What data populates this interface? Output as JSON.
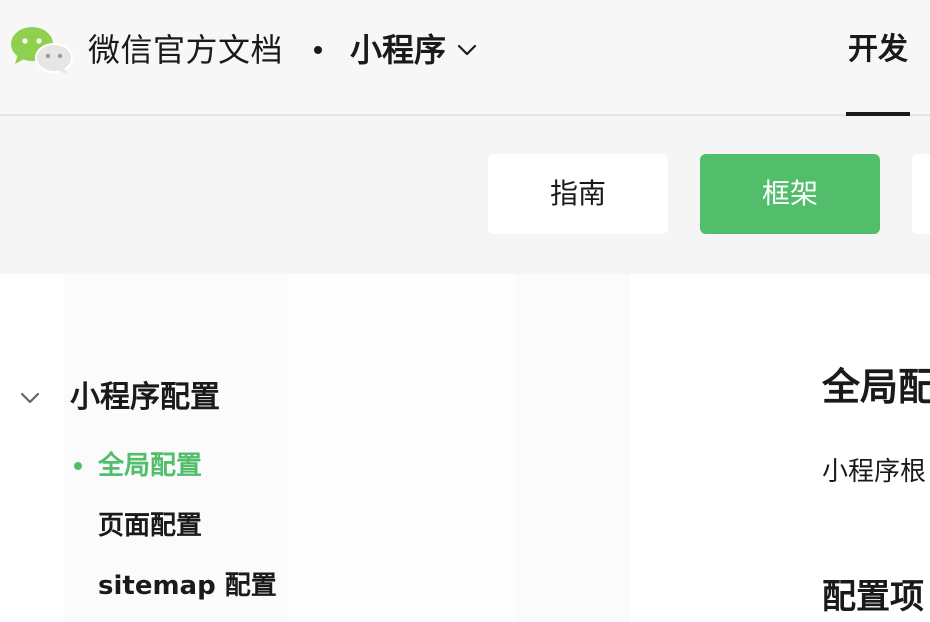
{
  "colors": {
    "accent": "#52bd6b",
    "text": "#1a1a1a",
    "header_bg": "#f7f7f7",
    "subbar_bg": "#f5f5f5"
  },
  "header": {
    "logo_icon": "wechat-logo-icon",
    "site_title": "微信官方文档",
    "product": "小程序",
    "product_chevron_icon": "chevron-down-icon",
    "nav_active": "开发"
  },
  "subtabs": [
    {
      "label": "指南",
      "active": false
    },
    {
      "label": "框架",
      "active": true
    }
  ],
  "sidebar": {
    "section_toggle_icon": "chevron-down-icon",
    "section_title": "小程序配置",
    "items": [
      {
        "label": "全局配置",
        "active": true
      },
      {
        "label": "页面配置",
        "active": false
      },
      {
        "label": "sitemap 配置",
        "active": false
      }
    ]
  },
  "article": {
    "heading": "全局配",
    "text": "小程序根",
    "subheading": "配置项"
  }
}
